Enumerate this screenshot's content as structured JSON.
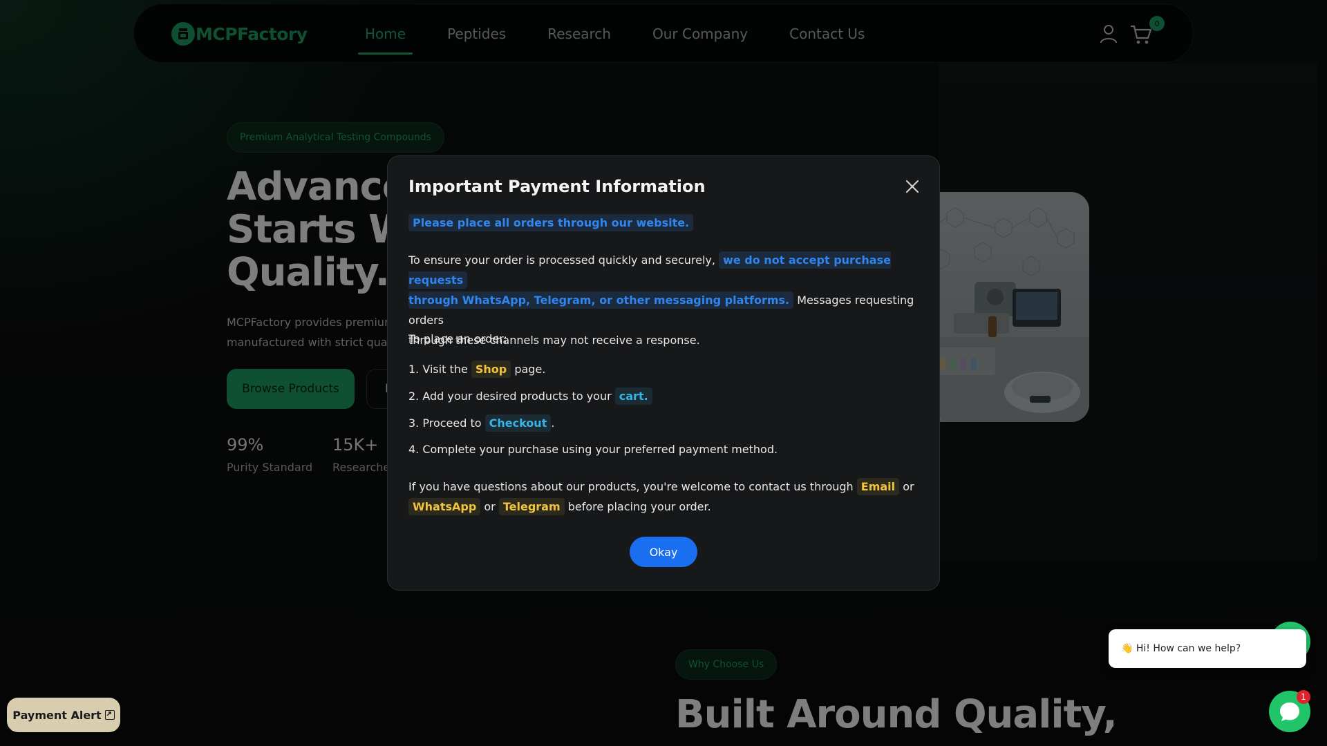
{
  "brand": {
    "name": "MCPFactory",
    "color": "#1c9a5e"
  },
  "nav": {
    "items": [
      {
        "label": "Home",
        "active": true
      },
      {
        "label": "Peptides",
        "active": false
      },
      {
        "label": "Research",
        "active": false
      },
      {
        "label": "Our Company",
        "active": false
      },
      {
        "label": "Contact Us",
        "active": false
      }
    ],
    "cart_count": "0"
  },
  "hero": {
    "badge": "Premium Analytical Testing Compounds",
    "title_lines": [
      "Advanced",
      "Starts W",
      "Quality."
    ],
    "subtitle_lines": [
      "MCPFactory provides premium r",
      "manufactured with strict quality"
    ],
    "primary_button": "Browse Products",
    "secondary_button": "E",
    "stats": [
      {
        "value": "99%",
        "label": "Purity Standard"
      },
      {
        "value": "15K+",
        "label": "Researcher"
      }
    ]
  },
  "why": {
    "badge": "Why Choose Us",
    "title": "Built Around Quality,"
  },
  "modal": {
    "title": "Important Payment Information",
    "lead": "Please place all orders through our website.",
    "para1_start": "To ensure your order is processed quickly and securely,",
    "para1_highlight_line1": "we do not accept purchase requests",
    "para1_highlight_line2": "through WhatsApp, Telegram, or other messaging platforms.",
    "para1_end_line1": "Messages requesting orders",
    "para1_end_line2": "through these channels may not receive a response.",
    "steps_intro": "To place an order:",
    "steps": [
      {
        "num": "1.",
        "before": "Visit the",
        "link": "Shop",
        "after": "page."
      },
      {
        "num": "2.",
        "before": "Add your desired products to your",
        "link": "cart.",
        "after": ""
      },
      {
        "num": "3.",
        "before": "Proceed to",
        "link": "Checkout",
        "after": "."
      },
      {
        "num": "4.",
        "before": "Complete your purchase using your preferred payment method.",
        "link": "",
        "after": ""
      }
    ],
    "contact_start": "If you have questions about our products, you're welcome to contact us through",
    "contact_email": "Email",
    "contact_or1": "or",
    "contact_whatsapp": "WhatsApp",
    "contact_or2": "or",
    "contact_telegram": "Telegram",
    "contact_end": "before placing your order.",
    "okay_button": "Okay"
  },
  "payment_alert": {
    "label": "Payment Alert"
  },
  "chat": {
    "greeting": "👋 Hi! How can we help?",
    "unread": "1"
  },
  "colors": {
    "accent_green": "#1c9a5e",
    "highlight_blue": "#2f86ee",
    "highlight_yellow": "#f3c43b",
    "highlight_cyan": "#3ab4e8",
    "okay_blue": "#1a6ff0"
  },
  "icons": [
    "user-icon",
    "cart-icon",
    "close-icon",
    "external-link-icon",
    "chat-icon"
  ]
}
